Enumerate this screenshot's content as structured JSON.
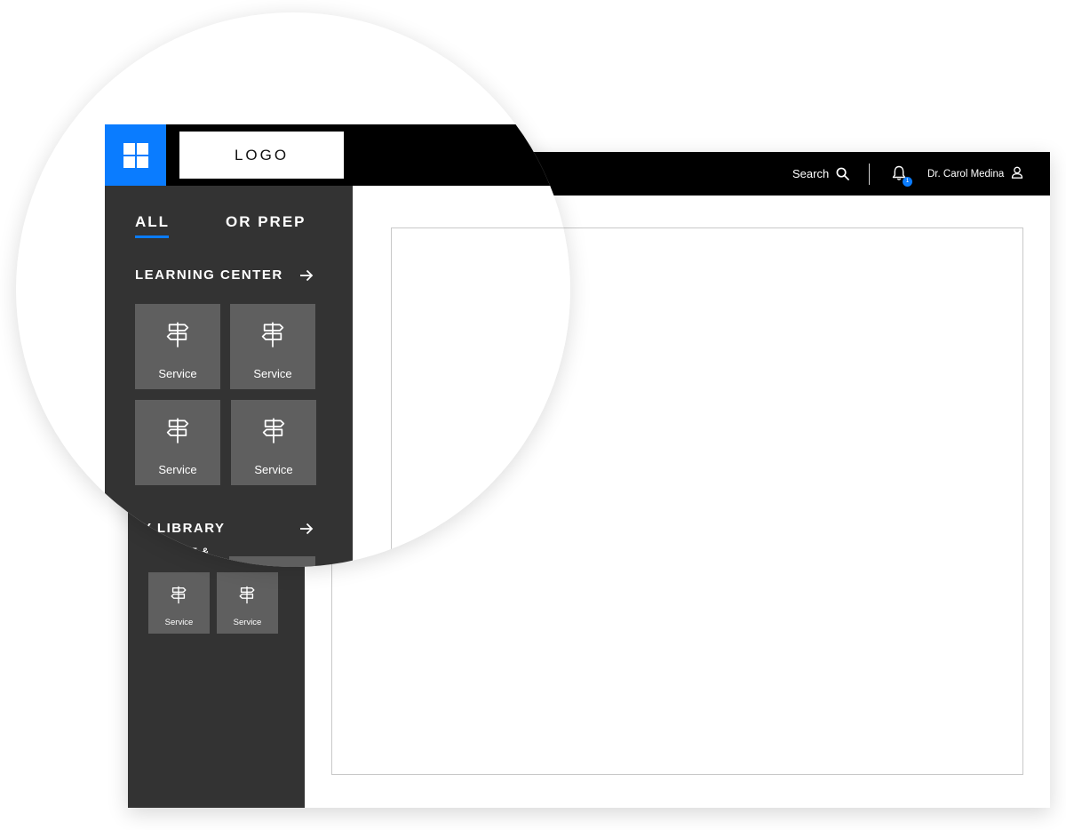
{
  "header": {
    "logo_text": "LOGO",
    "search_label": "Search",
    "notification_count": "1",
    "user_name": "Dr. Carol Medina"
  },
  "tabs": [
    {
      "label": "ALL",
      "active": true
    },
    {
      "label": "OR PREP",
      "active": false
    }
  ],
  "sections": {
    "learning_center": {
      "title": "LEARNING CENTER",
      "tiles": [
        {
          "label": "Service",
          "icon": "signpost-icon"
        },
        {
          "label": "Service",
          "icon": "signpost-icon"
        },
        {
          "label": "Service",
          "icon": "signpost-icon"
        },
        {
          "label": "Service",
          "icon": "signpost-icon"
        }
      ]
    },
    "library": {
      "title_visible": "Y LIBRARY",
      "subsection_visible": "SERVICE &",
      "tiles": [
        {
          "label": "Service",
          "icon": "signpost-icon"
        },
        {
          "label": "Service",
          "icon": "signpost-icon"
        }
      ]
    }
  },
  "colors": {
    "accent": "#0a7cff",
    "topbar": "#000000",
    "sidebar": "#333333",
    "tile": "#5f5f5f"
  }
}
